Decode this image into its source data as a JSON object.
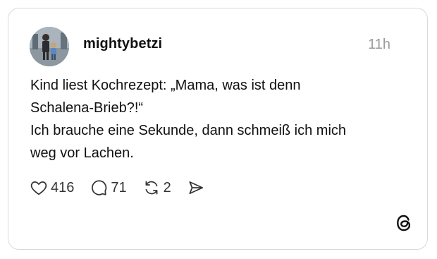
{
  "post": {
    "username": "mightybetzi",
    "time": "11h",
    "lines": [
      "Kind liest Kochrezept: „Mama, was ist denn",
      "Schalena-Brieb?!“",
      "Ich brauche eine Sekunde, dann schmeiß ich mich",
      "weg vor Lachen."
    ]
  },
  "actions": {
    "likes": "416",
    "comments": "71",
    "reposts": "2"
  },
  "icons": {
    "like": "heart-icon",
    "comment": "comment-icon",
    "repost": "repost-icon",
    "share": "send-icon",
    "brand": "threads-logo-icon"
  },
  "colors": {
    "text": "#111111",
    "muted": "#9b9b9b",
    "border": "#d9d9d9"
  }
}
